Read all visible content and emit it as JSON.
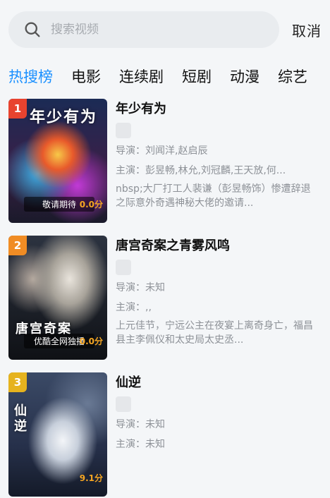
{
  "search": {
    "placeholder": "搜索视频",
    "cancel_label": "取消"
  },
  "tabs": [
    {
      "label": "热搜榜",
      "active": true
    },
    {
      "label": "电影",
      "active": false
    },
    {
      "label": "连续剧",
      "active": false
    },
    {
      "label": "短剧",
      "active": false
    },
    {
      "label": "动漫",
      "active": false
    },
    {
      "label": "综艺",
      "active": false
    }
  ],
  "items": [
    {
      "rank": "1",
      "rank_color": "#e8432f",
      "title": "年少有为",
      "director": "导演：刘闻洋,赵启辰",
      "cast": "主演：彭昱畅,林允,刘冠麟,王天放,何...",
      "description": "nbsp;大厂打工人裴谦（彭昱畅饰）惨遭辞退之际意外奇遇神秘大佬的邀请...",
      "poster_text": "年少有为",
      "poster_caption": "敬请期待",
      "poster_score": "0.0分"
    },
    {
      "rank": "2",
      "rank_color": "#f08c24",
      "title": "唐宫奇案之青雾风鸣",
      "director": "导演：未知",
      "cast": "主演：,,",
      "description": "上元佳节，宁远公主在夜宴上离奇身亡，福昌县主李佩仪和太史局太史丞...",
      "poster_text": "唐宫奇案",
      "poster_caption": "优酷全网独播",
      "poster_score": "0.0分"
    },
    {
      "rank": "3",
      "rank_color": "#e6b31e",
      "title": "仙逆",
      "director": "导演：未知",
      "cast": "主演：未知",
      "description": "",
      "poster_text": "仙逆",
      "poster_caption": "",
      "poster_score": "9.1分"
    }
  ]
}
